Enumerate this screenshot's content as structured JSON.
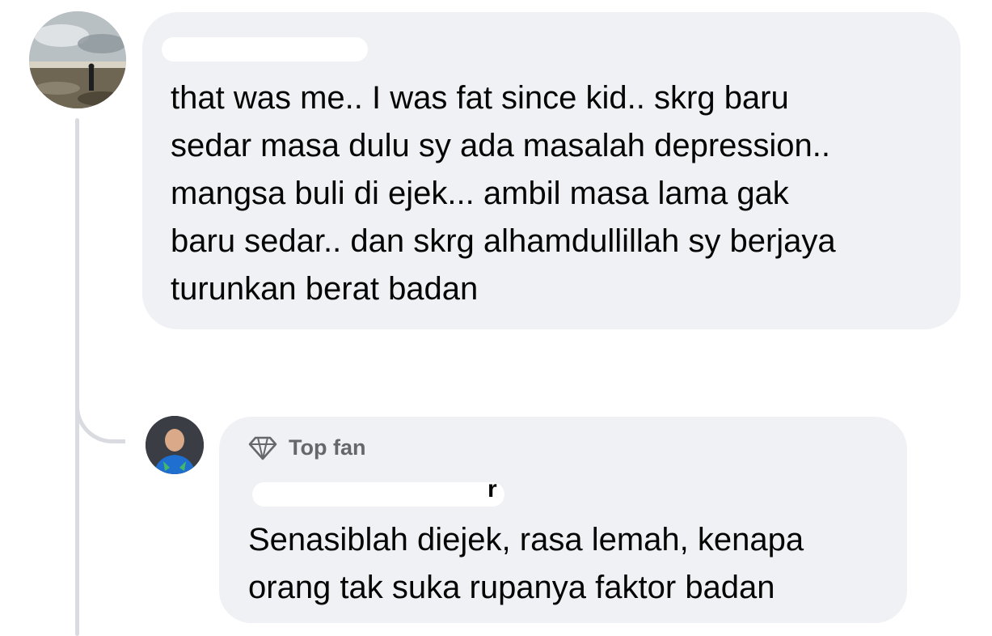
{
  "comments": [
    {
      "author_name_visible": "",
      "text": "that was me.. I was fat since kid.. skrg baru\nsedar masa dulu sy ada masalah depression..\nmangsa buli di ejek... ambil masa lama gak\nbaru sedar.. dan skrg alhamdullillah sy berjaya\nturunkan berat badan"
    },
    {
      "badge": "Top fan",
      "badge_icon": "diamond-icon",
      "author_name_visible": "r",
      "text": "Senasiblah diejek, rasa lemah, kenapa\norang tak suka  rupanya faktor badan"
    }
  ],
  "colors": {
    "bubble": "#f0f1f4",
    "text": "#050505",
    "badge_text": "#65676b",
    "thread_line": "#d9dbe0"
  }
}
